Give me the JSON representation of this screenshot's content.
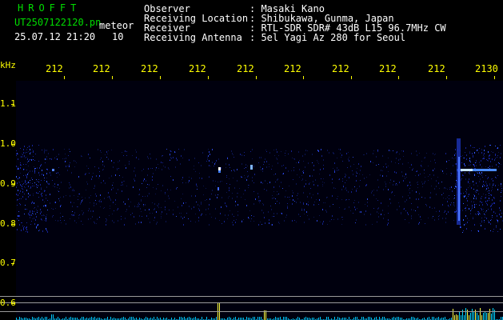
{
  "header": {
    "brand": "HROFFT",
    "filename": "UT2507122120.pn",
    "file_type": "meteor",
    "datetime": "25.07.12 21:20",
    "count": "10",
    "info_labels": [
      "Observer",
      "Receiving Location",
      "Receiver",
      "Receiving Antenna"
    ],
    "info_values": [
      ": Masaki Kano",
      ": Shibukawa, Gunma, Japan",
      ": RTL-SDR SDR# 43dB L15 96.7MHz CW",
      ": 5el Yagi Az 280 for Seoul"
    ]
  },
  "axes": {
    "y_unit": "kHz",
    "y_ticks": [
      "1.1",
      "1.0",
      "0.9",
      "0.8",
      "0.7",
      "0.6"
    ],
    "x_ticks": [
      "212",
      "212",
      "212",
      "212",
      "212",
      "212",
      "212",
      "212",
      "212",
      "2130"
    ]
  },
  "colors": {
    "background": "#000000",
    "plot_background": "#00000e",
    "text_green": "#00dd00",
    "text_white": "#ffffff",
    "axis_yellow": "#ffff00",
    "signal_blue": "#2f54ff",
    "signal_cyan": "#00d8ff",
    "signal_yellow": "#ffff40",
    "baseline_gray": "#9a9a9a"
  }
}
